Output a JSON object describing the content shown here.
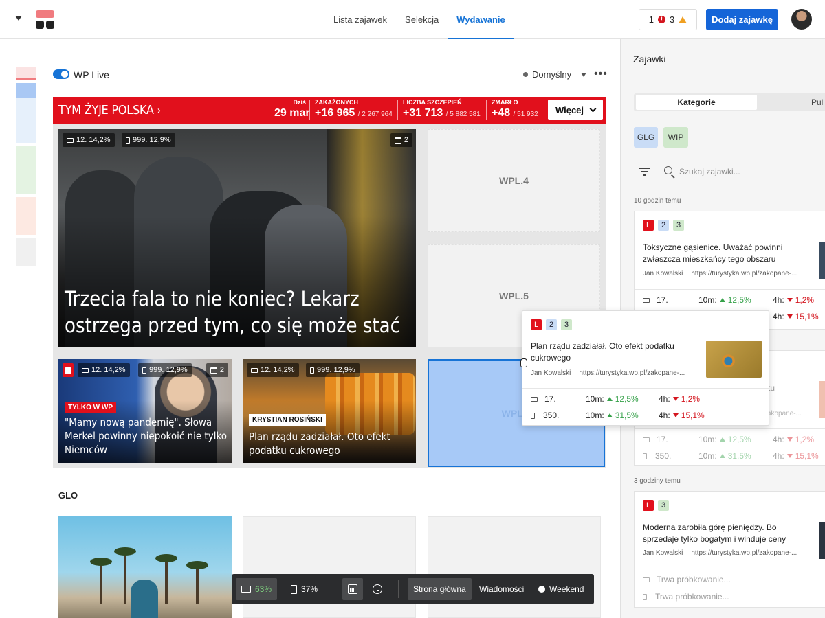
{
  "nav": {
    "tabs": [
      "Lista zajawek",
      "Selekcja",
      "Wydawanie"
    ],
    "active": "Wydawanie"
  },
  "alerts": {
    "errors": "1",
    "warnings": "3"
  },
  "add_button": "Dodaj zajawkę",
  "section": {
    "live_label": "WP Live",
    "preset": "Domyślny"
  },
  "banner": {
    "title": "TYM ŻYJE POLSKA",
    "stats": [
      {
        "label": "Dziś",
        "value": "29 mar",
        "sub": ""
      },
      {
        "label": "ZAKAŻONYCH",
        "value": "+16 965",
        "sub": "/ 2 267 964"
      },
      {
        "label": "LICZBA SZCZEPIEŃ",
        "value": "+31 713",
        "sub": "/ 5 882 581"
      },
      {
        "label": "ZMARŁO",
        "value": "+48",
        "sub": "/ 51 932"
      }
    ],
    "more": "Więcej"
  },
  "main_story": {
    "desktop": "12. 14,2%",
    "mobile": "999. 12,9%",
    "count": "2",
    "headline": "Trzecia fala to nie koniec? Lekarz ostrzega przed tym, co się może stać"
  },
  "slots": [
    "WPL.4",
    "WPL.5",
    "WPL.6"
  ],
  "story_a": {
    "desktop": "12. 14,2%",
    "mobile": "999. 12,9%",
    "count": "2",
    "tag": "TYLKO W WP",
    "caption": "\"Mamy nową pandemię\". Słowa Merkel powinny niepokoić nie tylko Niemców"
  },
  "story_b": {
    "desktop": "12. 14,2%",
    "mobile": "999. 12,9%",
    "tag": "KRYSTIAN ROSIŃSKI",
    "caption": "Plan rządu zadziałał. Oto efekt podatku cukrowego"
  },
  "glo_label": "GLO",
  "toolbar": {
    "desktop_pct": "63%",
    "mobile_pct": "37%",
    "home": "Strona główna",
    "news": "Wiadomości",
    "weekend": "Weekend"
  },
  "panel": {
    "title": "Zajawki",
    "tabs": [
      "Kategorie",
      "Pul"
    ],
    "tags": [
      "GLG",
      "WIP"
    ],
    "search_placeholder": "Szukaj zajawki...",
    "times": [
      "10 godzin temu",
      "3 godziny temu"
    ],
    "card1": {
      "badges": [
        "L",
        "2",
        "3"
      ],
      "title": "Toksyczne gąsienice. Uważać powinni zwłaszcza mieszkańcy tego obszaru",
      "author": "Jan Kowalski",
      "url": "https://turystyka.wp.pl/zakopane-...",
      "d_rank": "17.",
      "d_10m": "12,5%",
      "d_4h": "1,2%",
      "m_4h": "15,1%"
    },
    "card2_partial": {
      "title_tail": "ktu",
      "url": "https://turystyka.wp.pl/zakopane-...",
      "d_rank": "17.",
      "d_10m": "12,5%",
      "d_4h": "1,2%",
      "m_rank": "350.",
      "m_10m": "31,5%",
      "m_4h": "15,1%"
    },
    "card3": {
      "badges": [
        "L",
        "3"
      ],
      "title": "Moderna zarobiła górę pieniędzy. Bo sprzedaje tylko bogatym i winduje ceny",
      "author": "Jan Kowalski",
      "url": "https://turystyka.wp.pl/zakopane-...",
      "testing": "Trwa próbkowanie..."
    },
    "labels": {
      "m10": "10m:",
      "h4": "4h:"
    }
  },
  "popup": {
    "badges": [
      "L",
      "2",
      "3"
    ],
    "title": "Plan rządu zadziałał. Oto efekt podatku cukrowego",
    "author": "Jan Kowalski",
    "url": "https://turystyka.wp.pl/zakopane-...",
    "d_rank": "17.",
    "d_10m": "12,5%",
    "d_4h": "1,2%",
    "m_rank": "350.",
    "m_10m": "31,5%",
    "m_4h": "15,1%"
  }
}
